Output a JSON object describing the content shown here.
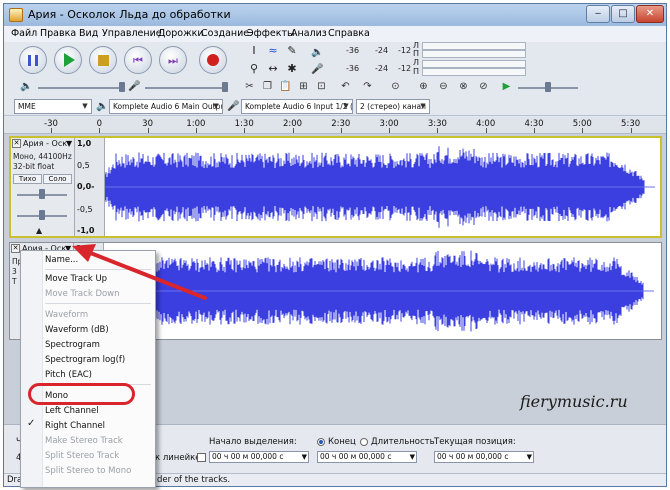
{
  "window": {
    "title": "Ария - Осколок Льда до обработки",
    "min_glyph": "‒",
    "max_glyph": "□",
    "close_glyph": "✕"
  },
  "menubar": [
    "Файл",
    "Правка",
    "Вид",
    "Управление",
    "Дорожки",
    "Создание",
    "Эффекты",
    "Анализ",
    "Справка"
  ],
  "meters": {
    "left_label": "Л",
    "right_label": "П",
    "ticks": [
      "-36",
      "-24",
      "-12",
      "0"
    ],
    "ticks2": [
      "-36",
      "-24",
      "-12",
      "0"
    ]
  },
  "devices": {
    "host": "MME",
    "output": "Komplete Audio 6 Main Output",
    "input": "Komplete Audio 6 Input 1/2 (K",
    "channels": "2 (стерео) канал"
  },
  "ruler": {
    "labels": [
      "-30",
      "0",
      "30",
      "1:00",
      "1:30",
      "2:00",
      "2:30",
      "3:00",
      "3:30",
      "4:00",
      "4:30",
      "5:00",
      "5:30"
    ]
  },
  "track1": {
    "name": "Ария - Оск",
    "info_line1": "Моно, 44100Hz",
    "info_line2": "32-bit float",
    "mute": "Тихо",
    "solo": "Соло",
    "scale": [
      "1,0",
      "0,5",
      "0,0-",
      "-0,5",
      "-1,0"
    ]
  },
  "track2": {
    "name": "Ария - Оск",
    "scale_top": "1,0",
    "info_partial_1": "Пр",
    "info_partial_2": "3",
    "info_partial_3": "Т"
  },
  "context_menu": {
    "items": [
      {
        "label": "Name...",
        "disabled": false,
        "checked": false
      },
      {
        "label": "Move Track Up",
        "disabled": false,
        "checked": false
      },
      {
        "label": "Move Track Down",
        "disabled": true,
        "checked": false
      },
      {
        "label": "Waveform",
        "disabled": true,
        "checked": false
      },
      {
        "label": "Waveform (dB)",
        "disabled": false,
        "checked": false
      },
      {
        "label": "Spectrogram",
        "disabled": false,
        "checked": false
      },
      {
        "label": "Spectrogram log(f)",
        "disabled": false,
        "checked": false
      },
      {
        "label": "Pitch (EAC)",
        "disabled": false,
        "checked": false
      },
      {
        "label": "Mono",
        "disabled": false,
        "checked": false
      },
      {
        "label": "Left Channel",
        "disabled": false,
        "checked": false
      },
      {
        "label": "Right Channel",
        "disabled": false,
        "checked": true
      },
      {
        "label": "Make Stereo Track",
        "disabled": true,
        "checked": false
      },
      {
        "label": "Split Stereo Track",
        "disabled": true,
        "checked": false
      },
      {
        "label": "Split Stereo to Mono",
        "disabled": true,
        "checked": false
      }
    ]
  },
  "bottom": {
    "snap_label": "к линейке",
    "selection_start_label": "Начало выделения:",
    "end_label": "Конец",
    "length_label": "Длительность",
    "current_position_label": "Текущая позиция:",
    "time_value": "00 ч 00 м 00,000 с",
    "partial_left": "Ч",
    "partial_left2": "4",
    "status_text": "der of the tracks.",
    "status_left": "Dra"
  },
  "watermark": "fierymusic.ru",
  "colors": {
    "waveform": "#3b3fe0",
    "waveform_peak": "#6a6ff0",
    "selected_track_border": "#c9c030",
    "highlight_ring": "#d9262c"
  }
}
